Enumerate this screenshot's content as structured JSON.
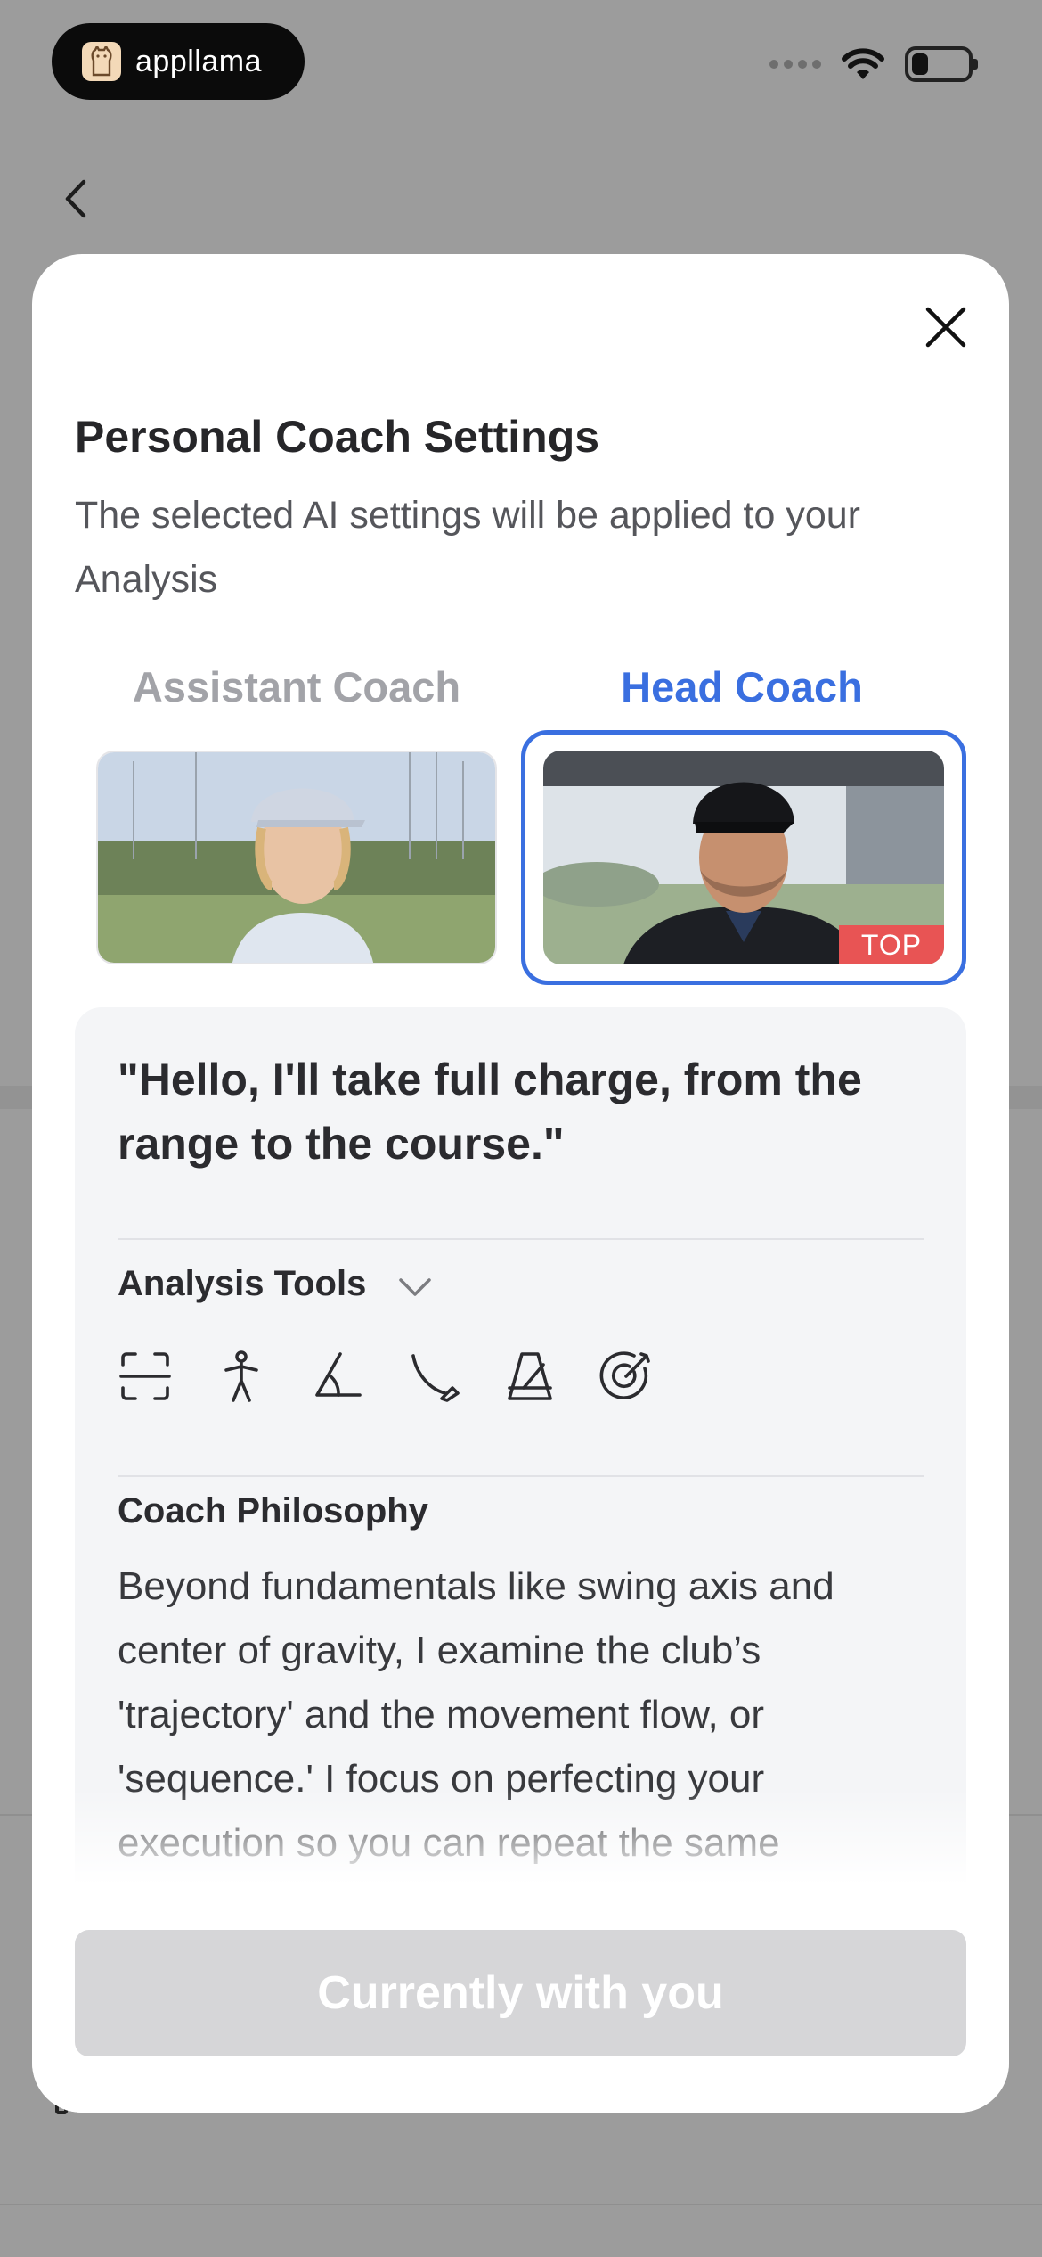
{
  "status_bar": {
    "brand_name": "appllama"
  },
  "modal": {
    "title": "Personal Coach Settings",
    "subtitle": "The selected AI settings will be applied to your Analysis",
    "coaches": [
      {
        "label": "Assistant Coach",
        "selected": false
      },
      {
        "label": "Head Coach",
        "selected": true,
        "badge": "TOP"
      }
    ],
    "quote": "\"Hello, I'll take full charge, from the range to the course.\"",
    "analysis_tools": {
      "label": "Analysis Tools",
      "icons": [
        "frame-scan-icon",
        "stick-figure-icon",
        "angle-icon",
        "club-path-icon",
        "metronome-icon",
        "target-icon"
      ]
    },
    "philosophy": {
      "label": "Coach Philosophy",
      "text": "Beyond fundamentals like swing axis and center of gravity, I examine the club’s 'trajectory' and the movement flow, or 'sequence.' I focus on perfecting your execution so you can repeat the same"
    },
    "cta_label": "Currently with you"
  },
  "colors": {
    "accent": "#3a6fe0",
    "badge": "#e85454",
    "muted_tab": "#a2a3a8",
    "cta_disabled": "#d6d6d8"
  }
}
